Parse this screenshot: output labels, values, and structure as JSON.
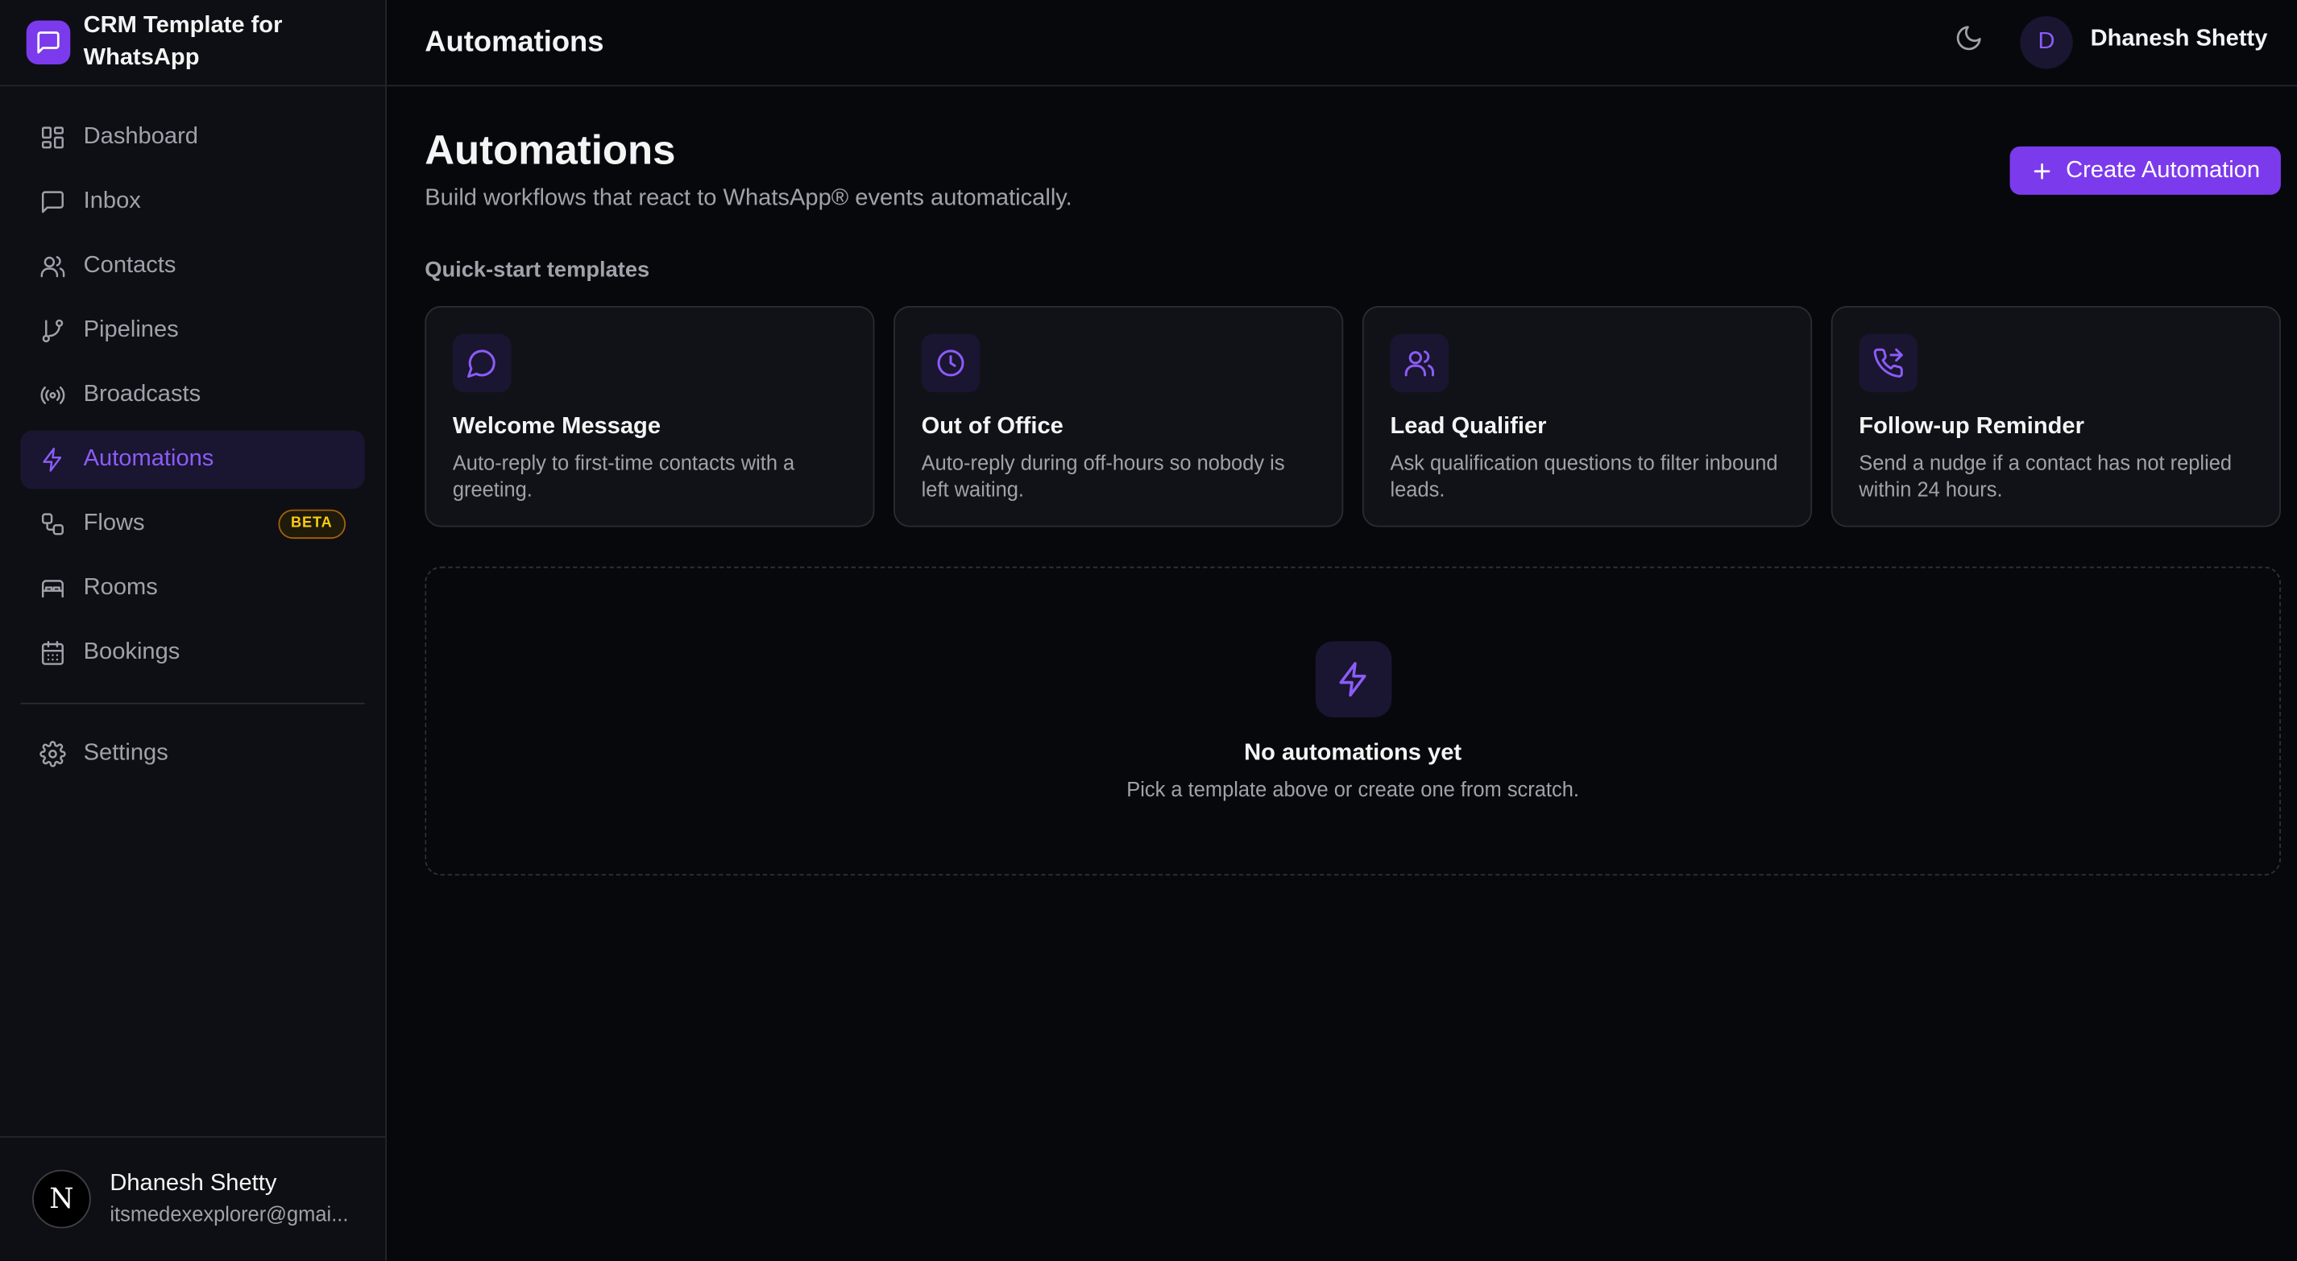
{
  "brand": {
    "name": "CRM Template for WhatsApp",
    "icon": "message-square-icon"
  },
  "nav": {
    "items": [
      {
        "label": "Dashboard",
        "icon": "layout-grid-icon"
      },
      {
        "label": "Inbox",
        "icon": "message-square-icon"
      },
      {
        "label": "Contacts",
        "icon": "users-icon"
      },
      {
        "label": "Pipelines",
        "icon": "git-branch-icon"
      },
      {
        "label": "Broadcasts",
        "icon": "radio-icon"
      },
      {
        "label": "Automations",
        "icon": "zap-icon",
        "active": true
      },
      {
        "label": "Flows",
        "icon": "workflow-icon",
        "badge": "BETA"
      },
      {
        "label": "Rooms",
        "icon": "bed-icon"
      },
      {
        "label": "Bookings",
        "icon": "calendar-icon"
      }
    ],
    "settings": {
      "label": "Settings",
      "icon": "gear-icon"
    }
  },
  "sidebar_user": {
    "initial": "N",
    "name": "Dhanesh Shetty",
    "email": "itsmedexexplorer@gmai..."
  },
  "header": {
    "title": "Automations",
    "avatar_initial": "D",
    "user_name": "Dhanesh Shetty",
    "theme_icon": "moon-icon"
  },
  "page": {
    "title": "Automations",
    "subtitle": "Build workflows that react to WhatsApp® events automatically.",
    "create_label": "Create Automation",
    "section_label": "Quick-start templates"
  },
  "templates": [
    {
      "title": "Welcome Message",
      "description": "Auto-reply to first-time contacts with a greeting.",
      "icon": "message-circle-icon"
    },
    {
      "title": "Out of Office",
      "description": "Auto-reply during off-hours so nobody is left waiting.",
      "icon": "clock-icon"
    },
    {
      "title": "Lead Qualifier",
      "description": "Ask qualification questions to filter inbound leads.",
      "icon": "users-icon"
    },
    {
      "title": "Follow-up Reminder",
      "description": "Send a nudge if a contact has not replied within 24 hours.",
      "icon": "phone-forwarded-icon"
    }
  ],
  "empty_state": {
    "title": "No automations yet",
    "subtitle": "Pick a template above or create one from scratch.",
    "icon": "zap-icon"
  },
  "colors": {
    "accent": "#7c3aed",
    "accent_text": "#8b5cf6",
    "background": "#07080c",
    "sidebar": "#0e0f14",
    "badge": "#facc15"
  }
}
